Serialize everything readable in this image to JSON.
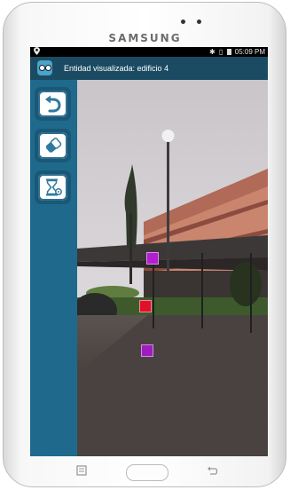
{
  "device": {
    "brand": "SAMSUNG"
  },
  "statusbar": {
    "left_icon": "location-icon",
    "right_icons": [
      "bluetooth-icon",
      "vibrate-icon",
      "battery-icon"
    ],
    "time": "05:09 PM"
  },
  "app": {
    "icon": "owl-app-icon",
    "title": "Entidad visualizada: edificio 4"
  },
  "toolbar": {
    "tools": [
      {
        "name": "undo",
        "icon": "undo-arrow-icon"
      },
      {
        "name": "erase",
        "icon": "eraser-icon"
      },
      {
        "name": "timer-settings",
        "icon": "hourglass-gear-icon"
      }
    ]
  },
  "markers": [
    {
      "color": "#b21fcf"
    },
    {
      "color": "#e0102a"
    },
    {
      "color": "#a01cc0"
    }
  ],
  "nav": {
    "recent_icon": "recent-apps-icon",
    "home": "home-button",
    "back_icon": "back-icon"
  }
}
